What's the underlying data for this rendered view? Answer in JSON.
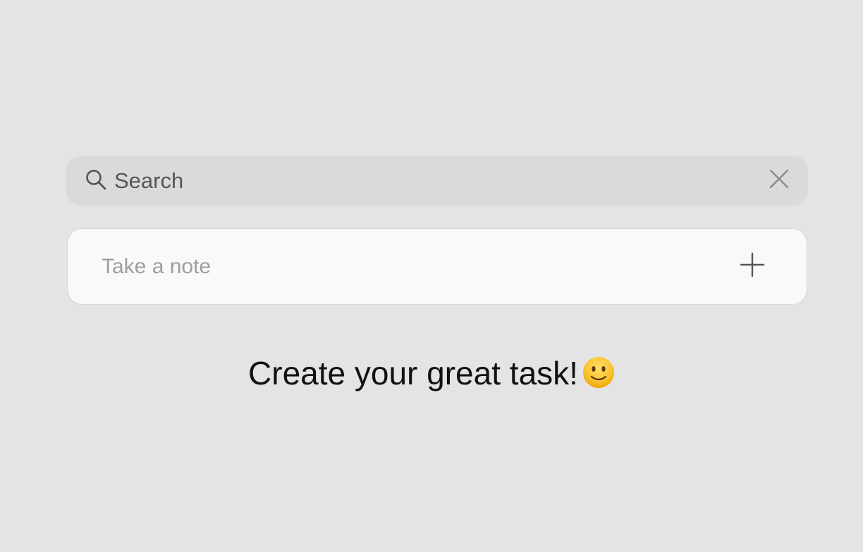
{
  "search": {
    "placeholder": "Search",
    "icon": "search-icon",
    "clear_icon": "close-icon"
  },
  "note": {
    "placeholder": "Take a note",
    "add_icon": "plus-icon"
  },
  "empty_state": {
    "message": "Create your great task!",
    "emoji_icon": "slightly-smiling-face-icon"
  },
  "colors": {
    "background": "#e4e4e4",
    "search_bar": "#dadada",
    "note_card": "#f9f9f9",
    "icon": "#555555"
  }
}
